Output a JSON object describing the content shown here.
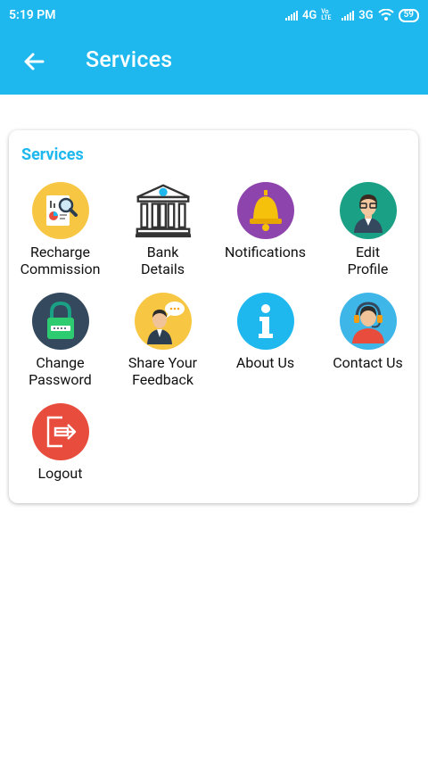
{
  "status": {
    "time": "5:19 PM",
    "network1": "4G",
    "volte": "Vo LTE",
    "network2": "3G",
    "battery": "59"
  },
  "header": {
    "title": "Services"
  },
  "card": {
    "title": "Services"
  },
  "services": [
    {
      "label1": "Recharge",
      "label2": "Commission",
      "icon": "recharge-commission-icon"
    },
    {
      "label1": "Bank",
      "label2": "Details",
      "icon": "bank-icon"
    },
    {
      "label1": "Notifications",
      "label2": "",
      "icon": "bell-icon"
    },
    {
      "label1": "Edit",
      "label2": "Profile",
      "icon": "profile-icon"
    },
    {
      "label1": "Change",
      "label2": "Password",
      "icon": "lock-icon"
    },
    {
      "label1": "Share Your",
      "label2": "Feedback",
      "icon": "feedback-icon"
    },
    {
      "label1": "About Us",
      "label2": "",
      "icon": "info-icon"
    },
    {
      "label1": "Contact Us",
      "label2": "",
      "icon": "support-agent-icon"
    },
    {
      "label1": "Logout",
      "label2": "",
      "icon": "logout-icon"
    }
  ],
  "colors": {
    "primary": "#1eb8ee",
    "card": "#ffffff"
  }
}
